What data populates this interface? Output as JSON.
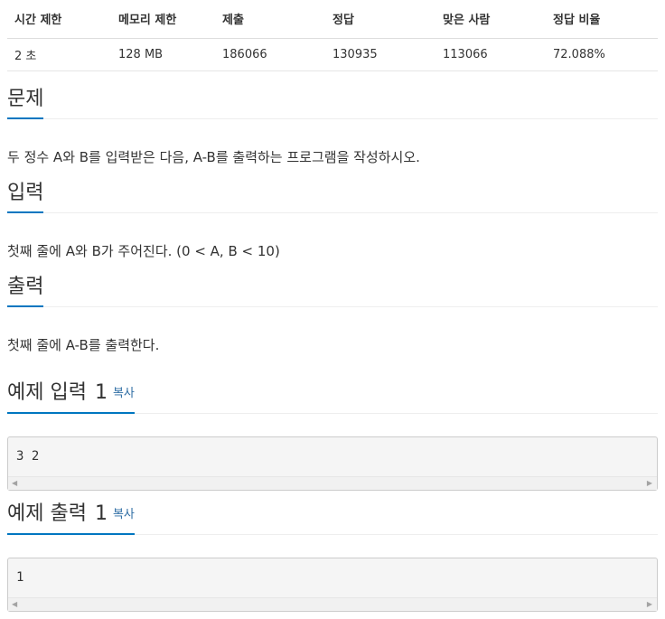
{
  "info_table": {
    "headers": [
      "시간 제한",
      "메모리 제한",
      "제출",
      "정답",
      "맞은 사람",
      "정답 비율"
    ],
    "values": [
      "2 초",
      "128 MB",
      "186066",
      "130935",
      "113066",
      "72.088%"
    ]
  },
  "sections": {
    "problem": {
      "title": "문제",
      "text": "두 정수 A와 B를 입력받은 다음, A-B를 출력하는 프로그램을 작성하시오."
    },
    "input": {
      "title": "입력",
      "text": "첫째 줄에 A와 B가 주어진다. (0 < A, B < 10)"
    },
    "output": {
      "title": "출력",
      "text": "첫째 줄에 A-B를 출력한다."
    }
  },
  "samples": {
    "input": {
      "title": "예제 입력",
      "number": "1",
      "copy_label": "복사",
      "content": "3 2"
    },
    "output": {
      "title": "예제 출력",
      "number": "1",
      "copy_label": "복사",
      "content": "1"
    }
  },
  "icons": {
    "scroll_left": "triangle-left",
    "scroll_right": "triangle-right"
  },
  "colors": {
    "accent": "#0076c0",
    "link": "#2e6da4",
    "sample_bg": "#f5f5f5"
  }
}
